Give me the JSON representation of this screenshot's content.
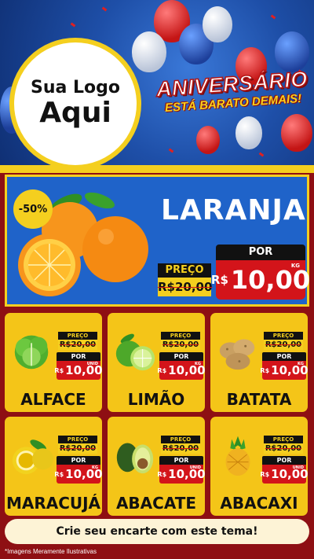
{
  "header": {
    "logo_line1": "Sua Logo",
    "logo_line2": "Aqui",
    "banner_line1": "ANIVERSÁRIO",
    "banner_line2": "ESTÁ BARATO DEMAIS!"
  },
  "featured": {
    "discount": "-50%",
    "name": "LARANJA",
    "preco_label": "PREÇO",
    "old_price": "R$20,00",
    "por_label": "POR",
    "currency": "R$",
    "price": "10,00",
    "unit": "KG"
  },
  "products": [
    {
      "name": "ALFACE",
      "preco_label": "PREÇO",
      "old_price": "R$20,00",
      "por_label": "POR",
      "currency": "R$",
      "price": "10,00",
      "unit": "UNID"
    },
    {
      "name": "LIMÃO",
      "preco_label": "PREÇO",
      "old_price": "R$20,00",
      "por_label": "POR",
      "currency": "R$",
      "price": "10,00",
      "unit": "KG"
    },
    {
      "name": "BATATA",
      "preco_label": "PREÇO",
      "old_price": "R$20,00",
      "por_label": "POR",
      "currency": "R$",
      "price": "10,00",
      "unit": "KG"
    },
    {
      "name": "MARACUJÁ",
      "preco_label": "PREÇO",
      "old_price": "R$20,00",
      "por_label": "POR",
      "currency": "R$",
      "price": "10,00",
      "unit": "KG"
    },
    {
      "name": "ABACATE",
      "preco_label": "PREÇO",
      "old_price": "R$20,00",
      "por_label": "POR",
      "currency": "R$",
      "price": "10,00",
      "unit": "UNID"
    },
    {
      "name": "ABACAXI",
      "preco_label": "PREÇO",
      "old_price": "R$20,00",
      "por_label": "POR",
      "currency": "R$",
      "price": "10,00",
      "unit": "UNID"
    }
  ],
  "footer": {
    "cta": "Crie seu encarte com este tema!",
    "disclaimer": "*Imagens Meramente Ilustrativas"
  },
  "colors": {
    "brand_red": "#d3141a",
    "brand_yellow": "#f4c518",
    "brand_blue": "#1f63c9",
    "background": "#8e0f13"
  }
}
